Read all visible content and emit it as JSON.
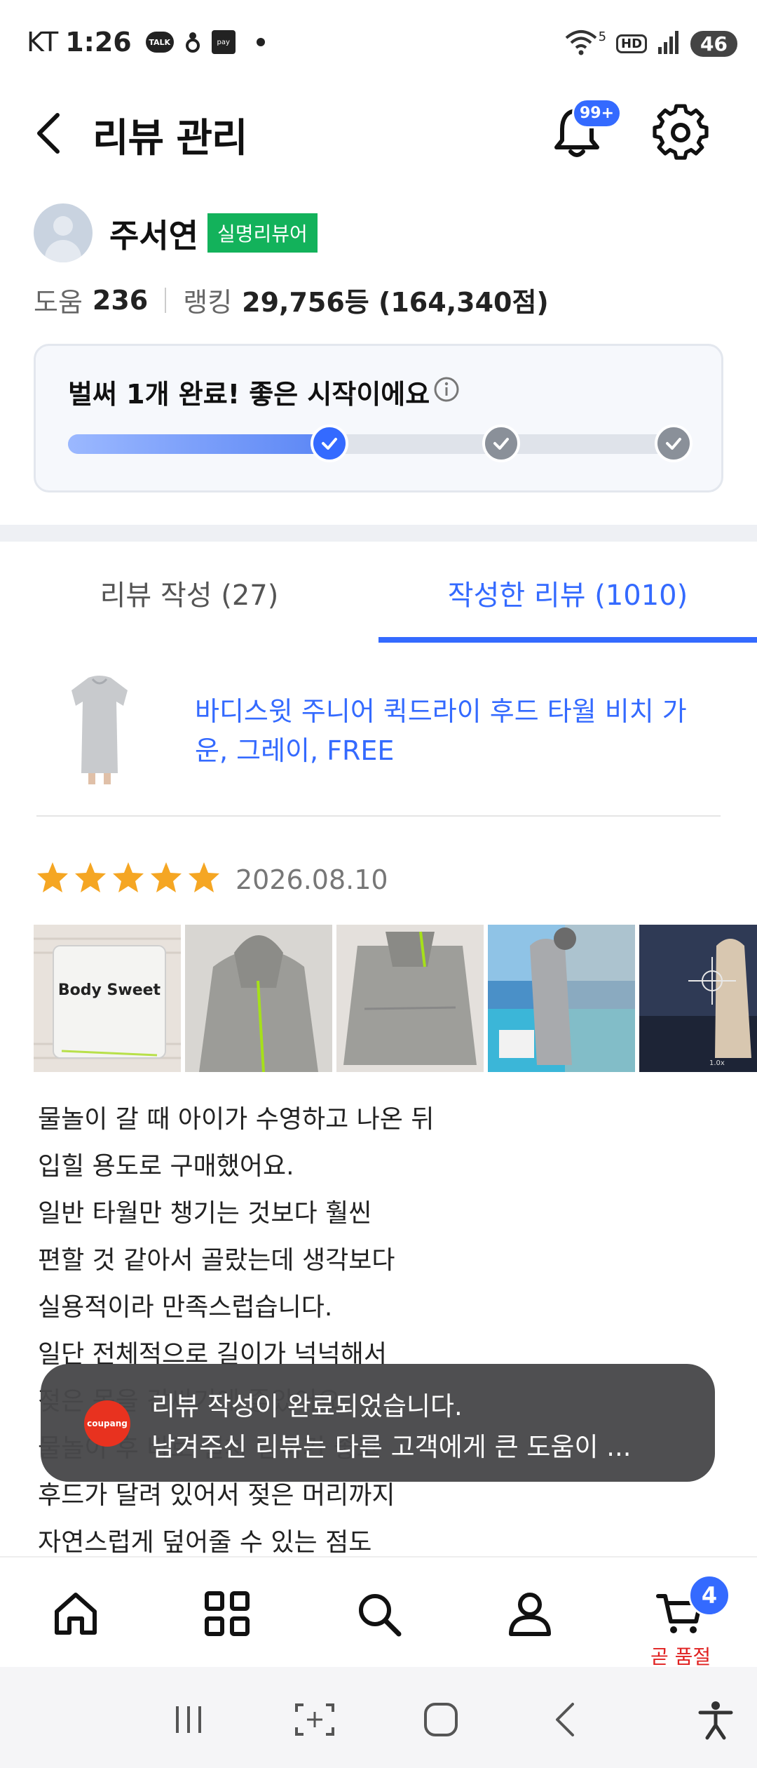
{
  "status_bar": {
    "carrier": "KT",
    "time": "1:26",
    "talk_icon_text": "TALK",
    "pay_icon_text": "pay",
    "signal_label": "5",
    "hd_label": "HD",
    "battery": "46"
  },
  "header": {
    "title": "리뷰 관리",
    "notification_badge": "99+"
  },
  "profile": {
    "name": "주서연",
    "badge": "실명리뷰어",
    "help_label": "도움",
    "help_value": "236",
    "ranking_label": "랭킹",
    "ranking_value": "29,756등 (164,340점)"
  },
  "progress": {
    "title": "벌써 1개 완료! 좋은 시작이에요",
    "fill_fraction": 0.42,
    "steps": [
      {
        "state": "done"
      },
      {
        "state": "todo"
      },
      {
        "state": "todo"
      }
    ]
  },
  "tabs": [
    {
      "label": "리뷰 작성 (27)",
      "active": false
    },
    {
      "label": "작성한 리뷰 (1010)",
      "active": true
    }
  ],
  "product": {
    "name": "바디스윗 주니어 퀵드라이 후드 타월 비치 가운, 그레이, FREE"
  },
  "review": {
    "rating": 5,
    "date": "2026.08.10",
    "photo_text": "Body Sweet",
    "zoom_text": "1.0x",
    "lines": [
      "물놀이 갈 때 아이가 수영하고 나온 뒤",
      "입힐 용도로 구매했어요.",
      "일반 타월만 챙기는 것보다 훨씬",
      "편할 것 같아서 골랐는데 생각보다",
      "실용적이라 만족스럽습니다.",
      "일단 전체적으로 길이가 넉넉해서",
      "젖은 몸을 감싸기에 좋았어요.",
      "물놀이 후 바로 걸쳐 입히기 좋고",
      "후드가 달려 있어서 젖은 머리까지",
      "자연스럽게 덮어줄 수 있는 점도"
    ]
  },
  "toast": {
    "logo_text": "coupang",
    "line1": "리뷰 작성이 완료되었습니다.",
    "line2": "남겨주신 리뷰는 다른 고객에게 큰 도움이 ..."
  },
  "bottom_nav": {
    "items": [
      "home-icon",
      "category-icon",
      "search-icon",
      "user-icon",
      "cart-icon"
    ],
    "cart_badge": "4",
    "cart_label": "곧 품절"
  },
  "colors": {
    "accent": "#346aff",
    "badge_green": "#13b25b",
    "star": "#f5a623",
    "sold_out_red": "#e02020"
  }
}
